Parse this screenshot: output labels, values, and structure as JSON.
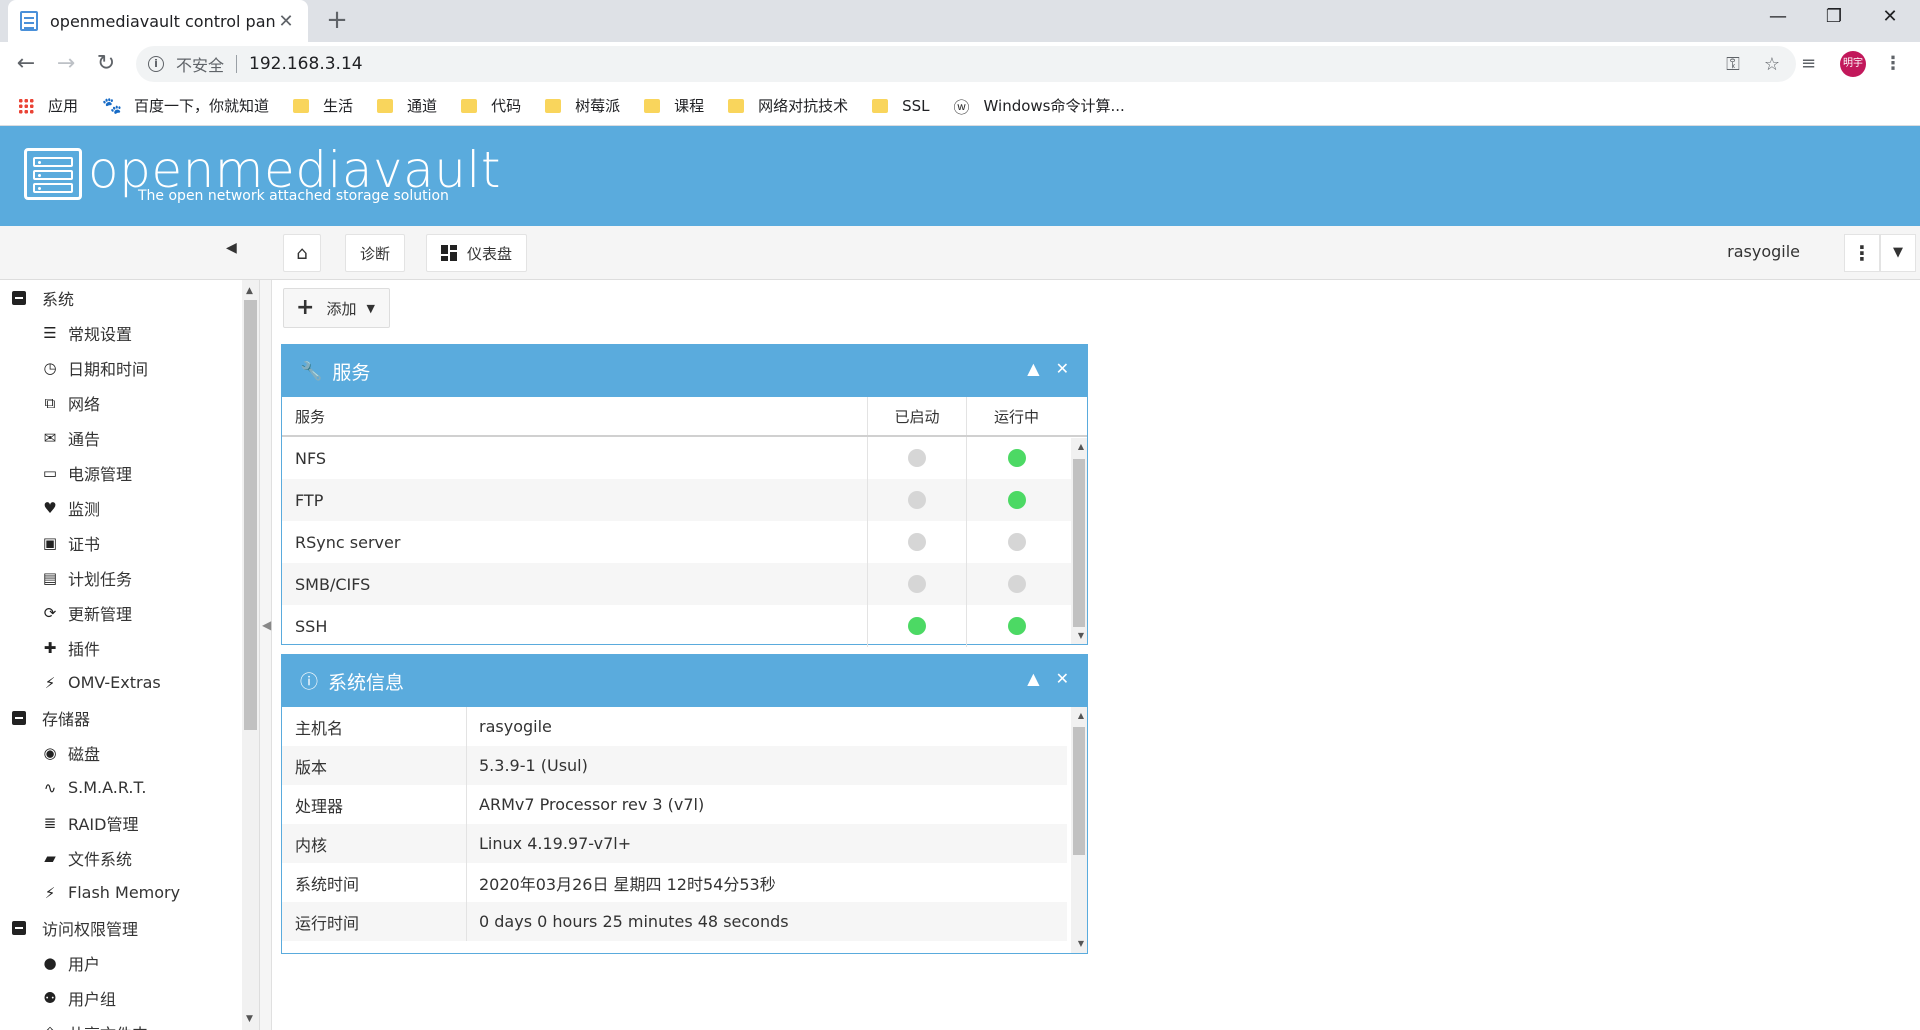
{
  "browser": {
    "tab_title": "openmediavault control panel",
    "new_tab_label": "+",
    "security_label": "不安全",
    "url": "192.168.3.14",
    "avatar_text": "明宇",
    "bookmarks": [
      {
        "label": "应用",
        "icon": "apps-icon"
      },
      {
        "label": "百度一下，你就知道",
        "icon": "baidu-paw-icon"
      },
      {
        "label": "生活",
        "icon": "folder-icon"
      },
      {
        "label": "通道",
        "icon": "folder-icon"
      },
      {
        "label": "代码",
        "icon": "folder-icon"
      },
      {
        "label": "树莓派",
        "icon": "folder-icon"
      },
      {
        "label": "课程",
        "icon": "folder-icon"
      },
      {
        "label": "网络对抗技术",
        "icon": "folder-icon"
      },
      {
        "label": "SSL",
        "icon": "folder-icon"
      },
      {
        "label": "Windows命令计算...",
        "icon": "ws-icon"
      }
    ]
  },
  "banner": {
    "name": "openmediavault",
    "tagline": "The open network attached storage solution"
  },
  "toolbar": {
    "crumb_diagnostics": "诊断",
    "crumb_dashboard": "仪表盘",
    "username": "rasyogile",
    "add_label": "添加"
  },
  "sidebar": {
    "groups": [
      {
        "label": "系统",
        "items": [
          {
            "label": "常规设置",
            "icon": "sliders-icon"
          },
          {
            "label": "日期和时间",
            "icon": "clock-icon"
          },
          {
            "label": "网络",
            "icon": "network-icon"
          },
          {
            "label": "通告",
            "icon": "envelope-icon"
          },
          {
            "label": "电源管理",
            "icon": "battery-icon"
          },
          {
            "label": "监测",
            "icon": "heartbeat-icon"
          },
          {
            "label": "证书",
            "icon": "certificate-icon"
          },
          {
            "label": "计划任务",
            "icon": "calendar-clock-icon"
          },
          {
            "label": "更新管理",
            "icon": "refresh-icon"
          },
          {
            "label": "插件",
            "icon": "puzzle-icon"
          },
          {
            "label": "OMV-Extras",
            "icon": "plug-icon"
          }
        ]
      },
      {
        "label": "存储器",
        "items": [
          {
            "label": "磁盘",
            "icon": "disk-icon"
          },
          {
            "label": "S.M.A.R.T.",
            "icon": "pulse-icon"
          },
          {
            "label": "RAID管理",
            "icon": "database-icon"
          },
          {
            "label": "文件系统",
            "icon": "folders-icon"
          },
          {
            "label": "Flash Memory",
            "icon": "bolt-icon"
          }
        ]
      },
      {
        "label": "访问权限管理",
        "items": [
          {
            "label": "用户",
            "icon": "user-icon"
          },
          {
            "label": "用户组",
            "icon": "users-icon"
          },
          {
            "label": "共享文件夹",
            "icon": "share-icon"
          }
        ]
      }
    ]
  },
  "services_panel": {
    "title": "服务",
    "columns": [
      "服务",
      "已启动",
      "运行中"
    ],
    "rows": [
      {
        "name": "NFS",
        "enabled": false,
        "running": true
      },
      {
        "name": "FTP",
        "enabled": false,
        "running": true
      },
      {
        "name": "RSync server",
        "enabled": false,
        "running": false
      },
      {
        "name": "SMB/CIFS",
        "enabled": false,
        "running": false
      },
      {
        "name": "SSH",
        "enabled": true,
        "running": true
      }
    ]
  },
  "sysinfo_panel": {
    "title": "系统信息",
    "rows": [
      {
        "key": "主机名",
        "value": "rasyogile"
      },
      {
        "key": "版本",
        "value": "5.3.9-1 (Usul)"
      },
      {
        "key": "处理器",
        "value": "ARMv7 Processor rev 3 (v7l)"
      },
      {
        "key": "内核",
        "value": "Linux 4.19.97-v7l+"
      },
      {
        "key": "系统时间",
        "value": "2020年03月26日 星期四 12时54分53秒"
      },
      {
        "key": "运行时间",
        "value": "0 days 0 hours 25 minutes 48 seconds"
      }
    ]
  },
  "colors": {
    "brand_blue": "#5aabdd",
    "status_on": "#4cd964",
    "status_off": "#d6d6d6"
  }
}
